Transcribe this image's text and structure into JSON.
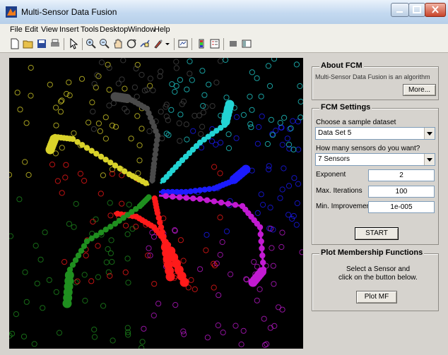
{
  "window": {
    "title": "Multi-Sensor Data Fusion"
  },
  "menu": [
    "File",
    "Edit",
    "View",
    "Insert",
    "Tools",
    "Desktop",
    "Window",
    "Help"
  ],
  "about": {
    "title": "About FCM",
    "text": "Multi-Sensor Data Fusion is an algorithm",
    "more_label": "More..."
  },
  "settings": {
    "title": "FCM Settings",
    "dataset_label": "Choose a sample dataset",
    "dataset_value": "Data Set 5",
    "sensors_label": "How many sensors do you want?",
    "sensors_value": "7 Sensors",
    "exponent_label": "Exponent",
    "exponent_value": "2",
    "iterations_label": "Max. Iterations",
    "iterations_value": "100",
    "improvement_label": "Min. Improvement",
    "improvement_value": "1e-005",
    "start_label": "START"
  },
  "plot_mf": {
    "title": "Plot Membership Functions",
    "instruction_line1": "Select a Sensor and",
    "instruction_line2": "click on the button below.",
    "button_label": "Plot MF"
  },
  "colors": {
    "gray": "#4a4a4a",
    "cyan": "#22d4d4",
    "blue": "#1b1bff",
    "magenta": "#c21ad2",
    "red": "#ff1a1a",
    "green": "#1f8f1f",
    "yellow": "#d9d22a"
  }
}
